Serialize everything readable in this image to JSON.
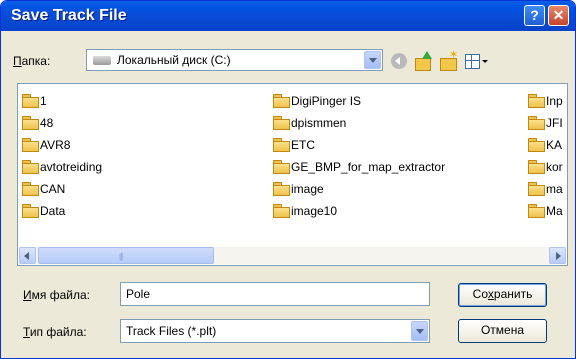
{
  "window": {
    "title": "Save Track File",
    "help_label": "?",
    "close_label": "✕"
  },
  "toolbar": {
    "folder_label_prefix": "П",
    "folder_label_rest": "апка:",
    "location": "Локальный диск (C:)",
    "icons": [
      "back-icon",
      "up-folder-icon",
      "new-folder-icon",
      "view-menu-icon"
    ]
  },
  "files": {
    "column1": [
      "1",
      "48",
      "AVR8",
      "avtotreiding",
      "CAN",
      "Data"
    ],
    "column2": [
      "DigiPinger IS",
      "dpismmen",
      "ETC",
      "GE_BMP_for_map_extractor",
      "image",
      "image10"
    ],
    "column3": [
      "Inp",
      "JFI",
      "KA",
      "kor",
      "ma",
      "Ma"
    ],
    "scroll_grip": "|||"
  },
  "form": {
    "filename_label_prefix": "И",
    "filename_label_rest": "мя файла:",
    "filename_value": "Pole",
    "filetype_label_prefix": "Т",
    "filetype_label_rest": "ип файла:",
    "filetype_value": "Track Files (*.plt)"
  },
  "buttons": {
    "save_prefix": "Со",
    "save_underline": "х",
    "save_rest": "ранить",
    "cancel": "Отмена"
  },
  "colors": {
    "titlebar": "#0054e3",
    "face": "#ece9d8",
    "border": "#7f9db9"
  }
}
